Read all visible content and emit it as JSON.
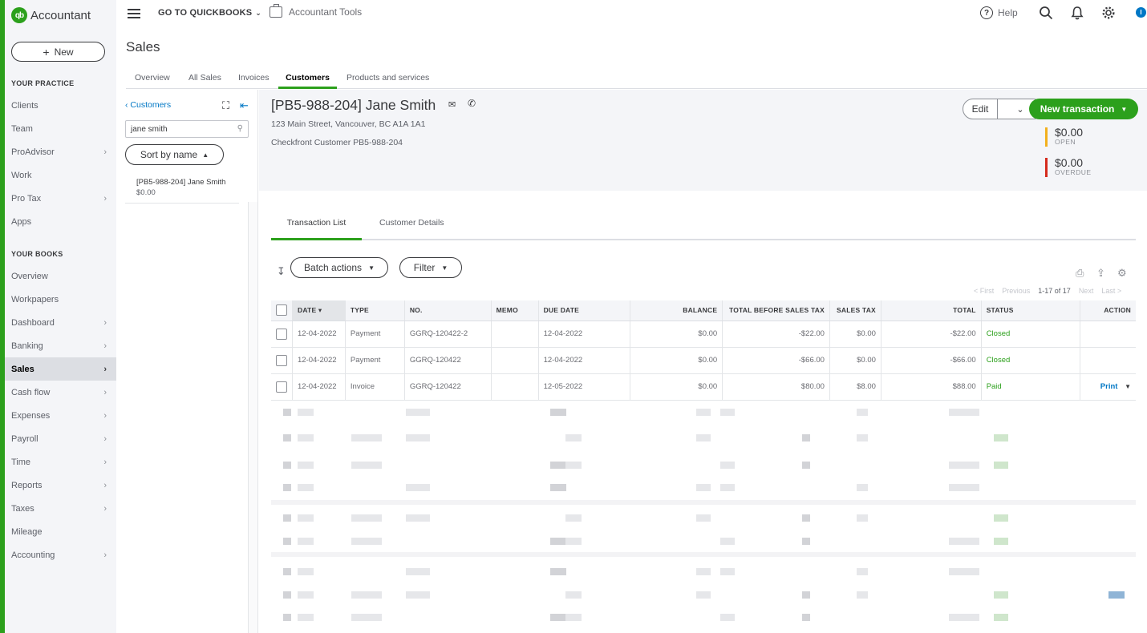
{
  "brand": {
    "logo": "qb",
    "name": "Accountant"
  },
  "sidebar": {
    "new_label": "New",
    "practice_heading": "YOUR PRACTICE",
    "practice_items": [
      {
        "label": "Clients",
        "chevron": false
      },
      {
        "label": "Team",
        "chevron": false
      },
      {
        "label": "ProAdvisor",
        "chevron": true
      },
      {
        "label": "Work",
        "chevron": false
      },
      {
        "label": "Pro Tax",
        "chevron": true
      },
      {
        "label": "Apps",
        "chevron": false
      }
    ],
    "books_heading": "YOUR BOOKS",
    "books_items": [
      {
        "label": "Overview",
        "chevron": false
      },
      {
        "label": "Workpapers",
        "chevron": false
      },
      {
        "label": "Dashboard",
        "chevron": true
      },
      {
        "label": "Banking",
        "chevron": true
      },
      {
        "label": "Sales",
        "chevron": true,
        "active": true
      },
      {
        "label": "Cash flow",
        "chevron": true
      },
      {
        "label": "Expenses",
        "chevron": true
      },
      {
        "label": "Payroll",
        "chevron": true
      },
      {
        "label": "Time",
        "chevron": true
      },
      {
        "label": "Reports",
        "chevron": true
      },
      {
        "label": "Taxes",
        "chevron": true
      },
      {
        "label": "Mileage",
        "chevron": false
      },
      {
        "label": "Accounting",
        "chevron": true
      }
    ]
  },
  "topbar": {
    "goto_label": "GO TO QUICKBOOKS",
    "accountant_tools": "Accountant Tools",
    "help": "Help",
    "user_initial": "I"
  },
  "page": {
    "title": "Sales",
    "tabs": [
      "Overview",
      "All Sales",
      "Invoices",
      "Customers",
      "Products and services"
    ],
    "active_tab": "Customers"
  },
  "list_panel": {
    "back_link": "Customers",
    "search_value": "jane smith",
    "sort_label": "Sort by name",
    "items": [
      {
        "name": "[PB5-988-204] Jane Smith",
        "amount": "$0.00"
      }
    ]
  },
  "customer": {
    "name": "[PB5-988-204] Jane Smith",
    "address": "123 Main Street, Vancouver, BC A1A 1A1",
    "note": "Checkfront Customer PB5-988-204",
    "edit_label": "Edit",
    "new_transaction_label": "New transaction",
    "open_amount": "$0.00",
    "open_label": "OPEN",
    "overdue_amount": "$0.00",
    "overdue_label": "OVERDUE",
    "colors": {
      "open": "#f2b01e",
      "overdue": "#d52b1e",
      "accent": "#2ca01c"
    }
  },
  "subtabs": [
    "Transaction List",
    "Customer Details"
  ],
  "toolbar": {
    "batch_actions": "Batch actions",
    "filter": "Filter",
    "pager": {
      "first": "< First",
      "previous": "Previous",
      "count": "1-17 of 17",
      "next": "Next",
      "last": "Last >"
    }
  },
  "table": {
    "columns": [
      "DATE",
      "TYPE",
      "NO.",
      "MEMO",
      "DUE DATE",
      "BALANCE",
      "TOTAL BEFORE SALES TAX",
      "SALES TAX",
      "TOTAL",
      "STATUS",
      "ACTION"
    ],
    "rows": [
      {
        "date": "12-04-2022",
        "type": "Payment",
        "no": "GGRQ-120422-2",
        "memo": "",
        "due": "12-04-2022",
        "balance": "$0.00",
        "before_tax": "-$22.00",
        "tax": "$0.00",
        "total": "-$22.00",
        "status": "Closed",
        "action": ""
      },
      {
        "date": "12-04-2022",
        "type": "Payment",
        "no": "GGRQ-120422",
        "memo": "",
        "due": "12-04-2022",
        "balance": "$0.00",
        "before_tax": "-$66.00",
        "tax": "$0.00",
        "total": "-$66.00",
        "status": "Closed",
        "action": ""
      },
      {
        "date": "12-04-2022",
        "type": "Invoice",
        "no": "GGRQ-120422",
        "memo": "",
        "due": "12-05-2022",
        "balance": "$0.00",
        "before_tax": "$80.00",
        "tax": "$8.00",
        "total": "$88.00",
        "status": "Paid",
        "action": "Print"
      }
    ]
  }
}
